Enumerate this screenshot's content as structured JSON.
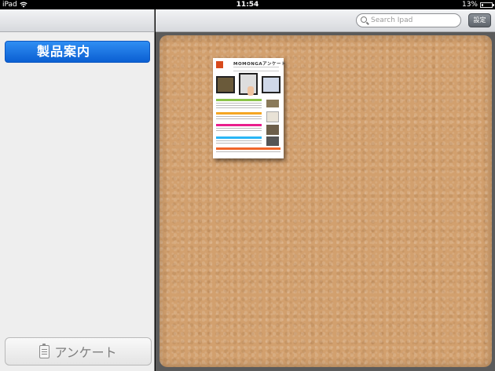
{
  "status_bar": {
    "device": "iPad",
    "time": "11:54",
    "battery": "13%",
    "battery_level": 0.13
  },
  "sidebar": {
    "product_button_label": "製品案内",
    "survey_button_label": "アンケート",
    "survey_icon": "clipboard-icon"
  },
  "toolbar": {
    "search_placeholder": "Search Ipad",
    "settings_label": "設定"
  },
  "board": {
    "documents": [
      {
        "title": "MOMONGAアンケート"
      }
    ]
  },
  "colors": {
    "accent_blue": "#1a74e6",
    "cork": "#d2a06e",
    "doc_bands": [
      "#8bc34a",
      "#f5a623",
      "#e91e8c",
      "#29b6f6",
      "#f06529"
    ]
  }
}
